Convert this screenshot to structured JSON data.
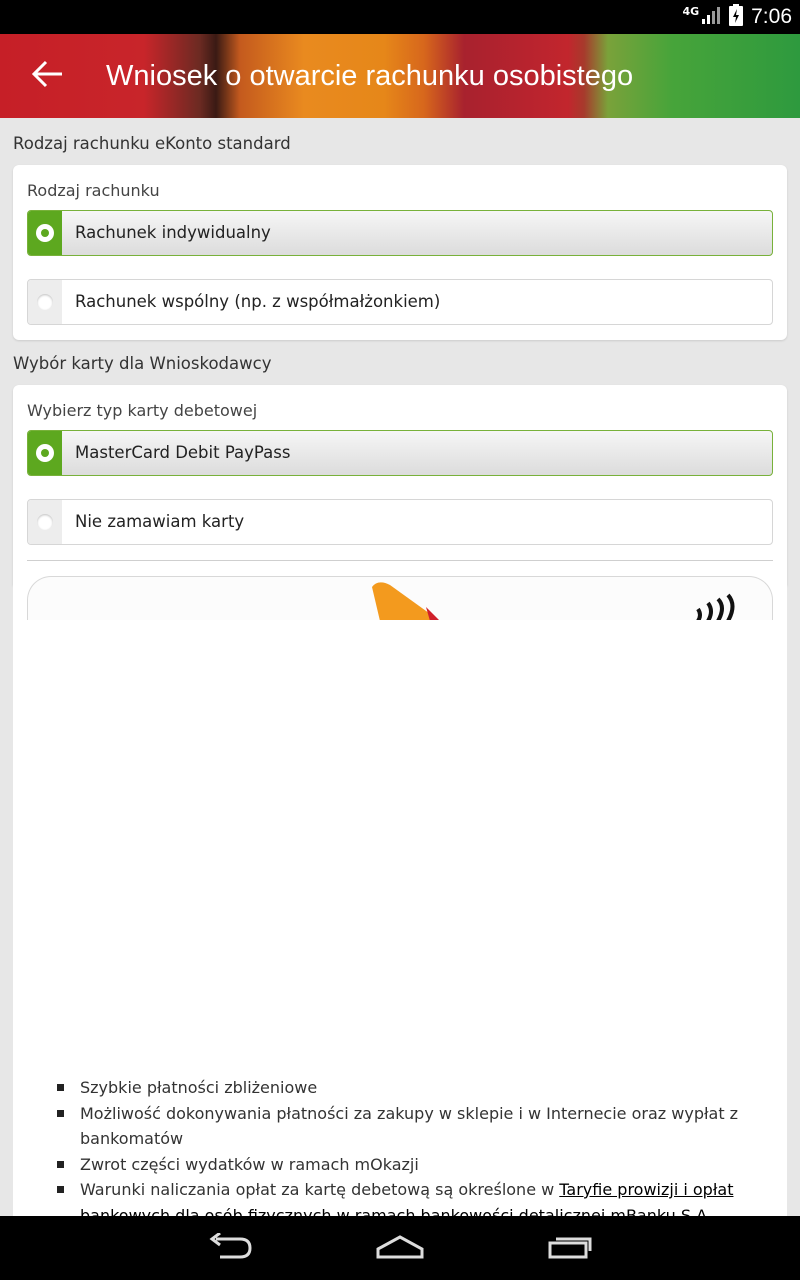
{
  "status_bar": {
    "network": "4G",
    "time": "7:06",
    "icons": [
      "signal-icon",
      "battery-icon"
    ]
  },
  "app_bar": {
    "title": "Wniosek o otwarcie rachunku osobistego",
    "back_icon": "arrow-left-icon"
  },
  "account_section": {
    "header": "Rodzaj rachunku eKonto standard",
    "label": "Rodzaj rachunku",
    "options": [
      {
        "label": "Rachunek indywidualny",
        "selected": true
      },
      {
        "label": "Rachunek wspólny (np. z współmałżonkiem)",
        "selected": false
      }
    ]
  },
  "card_section": {
    "header": "Wybór karty dla Wnioskodawcy",
    "label": "Wybierz typ karty debetowej",
    "options": [
      {
        "label": "MasterCard Debit PayPass",
        "selected": true
      },
      {
        "label": "Nie zamawiam karty",
        "selected": false
      }
    ]
  },
  "features": {
    "items": [
      "Szybkie płatności zbliżeniowe",
      "Możliwość dokonywania płatności za zakupy w sklepie i w Internecie oraz wypłat z bankomatów",
      "Zwrot części wydatków w ramach mOkazji"
    ],
    "last_item_prefix": "Warunki naliczania opłat za kartę debetową są określone w ",
    "last_item_link": "Taryfie prowizji i opłat bankowych dla osób fizycznych w ramach bankowości detalicznej mBanku S.A."
  },
  "nav_bar": {
    "icons": [
      "back-nav-icon",
      "home-nav-icon",
      "recents-nav-icon"
    ]
  },
  "colors": {
    "accent_green": "#5da81f",
    "status_bar": "#000000",
    "background": "#e7e7e7"
  }
}
